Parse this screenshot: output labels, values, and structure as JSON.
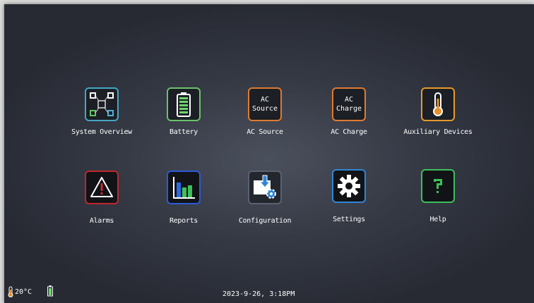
{
  "tiles": [
    {
      "label": "System Overview",
      "icon": "network-icon",
      "border": "#44a7c4"
    },
    {
      "label": "Battery",
      "icon": "battery-icon",
      "border": "#6cc26c"
    },
    {
      "label": "AC Source",
      "icon_text_1": "AC",
      "icon_text_2": "Source",
      "border": "#e07a30"
    },
    {
      "label": "AC Charge",
      "icon_text_1": "AC",
      "icon_text_2": "Charge",
      "border": "#e07a30"
    },
    {
      "label": "Auxiliary Devices",
      "icon": "thermometer-icon",
      "border": "#e89a2a"
    },
    {
      "label": "Alarms",
      "icon": "warning-icon",
      "border": "#c0272d"
    },
    {
      "label": "Reports",
      "icon": "bar-chart-icon",
      "border": "#2a5bd7"
    },
    {
      "label": "Configuration",
      "icon": "config-download-gear-icon",
      "border": "#5a6270"
    },
    {
      "label": "Settings",
      "icon": "gear-icon",
      "border": "#2f86d6"
    },
    {
      "label": "Help",
      "icon": "question-icon",
      "border": "#3fbf5a"
    }
  ],
  "status_bar": {
    "temperature": "20°C",
    "datetime": "2023-9-26, 3:18PM"
  }
}
